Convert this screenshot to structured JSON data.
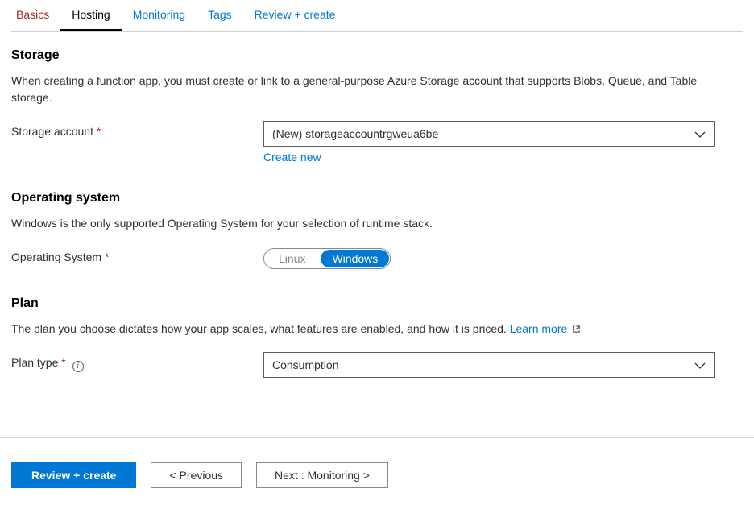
{
  "tabs": {
    "basics": "Basics",
    "hosting": "Hosting",
    "monitoring": "Monitoring",
    "tags": "Tags",
    "review": "Review + create"
  },
  "storage": {
    "heading": "Storage",
    "desc": "When creating a function app, you must create or link to a general-purpose Azure Storage account that supports Blobs, Queue, and Table storage.",
    "account_label": "Storage account",
    "account_value": "(New) storageaccountrgweua6be",
    "create_new": "Create new"
  },
  "os": {
    "heading": "Operating system",
    "desc": "Windows is the only supported Operating System for your selection of runtime stack.",
    "label": "Operating System",
    "linux": "Linux",
    "windows": "Windows"
  },
  "plan": {
    "heading": "Plan",
    "desc_prefix": "The plan you choose dictates how your app scales, what features are enabled, and how it is priced. ",
    "learn_more": "Learn more",
    "type_label": "Plan type",
    "type_value": "Consumption"
  },
  "footer": {
    "review": "Review + create",
    "previous": "<  Previous",
    "next": "Next : Monitoring  >"
  },
  "required_marker": "*"
}
